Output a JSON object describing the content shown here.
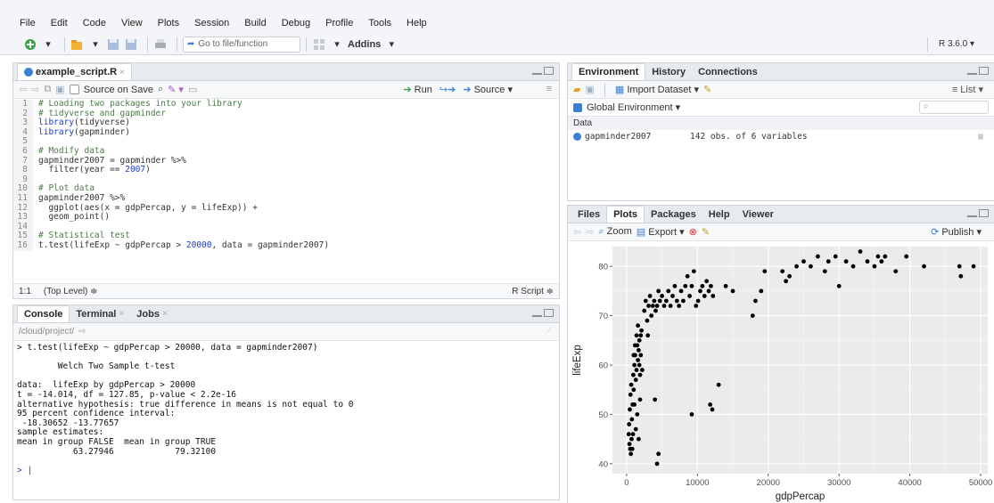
{
  "menu": [
    "File",
    "Edit",
    "Code",
    "View",
    "Plots",
    "Session",
    "Build",
    "Debug",
    "Profile",
    "Tools",
    "Help"
  ],
  "toolbar": {
    "goto_placeholder": "Go to file/function",
    "addins_label": "Addins",
    "r_version": "R 3.6.0"
  },
  "editor": {
    "tab_label": "example_script.R",
    "source_on_save": "Source on Save",
    "run_label": "Run",
    "source_label": "Source",
    "lines": [
      {
        "n": "1",
        "html": "<span class='comment'># Loading two packages into your library</span>"
      },
      {
        "n": "2",
        "html": "<span class='comment'># tidyverse and gapminder</span>"
      },
      {
        "n": "3",
        "html": "<span class='kw'>library</span>(tidyverse)"
      },
      {
        "n": "4",
        "html": "<span class='kw'>library</span>(gapminder)"
      },
      {
        "n": "5",
        "html": ""
      },
      {
        "n": "6",
        "html": "<span class='comment'># Modify data</span>"
      },
      {
        "n": "7",
        "html": "gapminder2007 = gapminder %&gt;%"
      },
      {
        "n": "8",
        "html": "  filter(year == <span class='num'>2007</span>)"
      },
      {
        "n": "9",
        "html": ""
      },
      {
        "n": "10",
        "html": "<span class='comment'># Plot data</span>"
      },
      {
        "n": "11",
        "html": "gapminder2007 %&gt;%"
      },
      {
        "n": "12",
        "html": "  ggplot(aes(x = gdpPercap, y = lifeExp)) +"
      },
      {
        "n": "13",
        "html": "  geom_point()"
      },
      {
        "n": "14",
        "html": ""
      },
      {
        "n": "15",
        "html": "<span class='comment'># Statistical test</span>"
      },
      {
        "n": "16",
        "html": "t.test(lifeExp ~ gdpPercap &gt; <span class='num'>20000</span>, data = gapminder2007)"
      }
    ],
    "status_pos": "1:1",
    "status_level": "(Top Level) ≑",
    "status_type": "R Script ≑"
  },
  "console": {
    "tabs": [
      "Console",
      "Terminal",
      "Jobs"
    ],
    "path": "/cloud/project/",
    "output": "> t.test(lifeExp ~ gdpPercap > 20000, data = gapminder2007)\n\n        Welch Two Sample t-test\n\ndata:  lifeExp by gdpPercap > 20000\nt = -14.014, df = 127.85, p-value < 2.2e-16\nalternative hypothesis: true difference in means is not equal to 0\n95 percent confidence interval:\n -18.30652 -13.77657\nsample estimates:\nmean in group FALSE  mean in group TRUE\n           63.27946            79.32100\n\n",
    "prompt": "> |"
  },
  "environment": {
    "tabs": [
      "Environment",
      "History",
      "Connections"
    ],
    "import_label": "Import Dataset",
    "list_label": "List",
    "scope_label": "Global Environment",
    "section": "Data",
    "var_name": "gapminder2007",
    "var_desc": "142 obs. of 6 variables"
  },
  "plots": {
    "tabs": [
      "Files",
      "Plots",
      "Packages",
      "Help",
      "Viewer"
    ],
    "zoom_label": "Zoom",
    "export_label": "Export",
    "publish_label": "Publish"
  },
  "chart_data": {
    "type": "scatter",
    "xlabel": "gdpPercap",
    "ylabel": "lifeExp",
    "xlim": [
      -2000,
      51000
    ],
    "ylim": [
      38,
      84
    ],
    "xticks": [
      0,
      10000,
      20000,
      30000,
      40000,
      50000
    ],
    "xtick_labels": [
      "0",
      "10000",
      "20000",
      "30000",
      "40000",
      "50000"
    ],
    "yticks": [
      40,
      50,
      60,
      70,
      80
    ],
    "ytick_labels": [
      "40",
      "50",
      "60",
      "70",
      "80"
    ],
    "grid": true,
    "points": [
      [
        300,
        46
      ],
      [
        400,
        44
      ],
      [
        500,
        43
      ],
      [
        600,
        42
      ],
      [
        700,
        45
      ],
      [
        800,
        43
      ],
      [
        900,
        46
      ],
      [
        350,
        48
      ],
      [
        450,
        51
      ],
      [
        550,
        54
      ],
      [
        650,
        56
      ],
      [
        750,
        49
      ],
      [
        850,
        52
      ],
      [
        950,
        58
      ],
      [
        1000,
        55
      ],
      [
        1100,
        60
      ],
      [
        1200,
        62
      ],
      [
        1300,
        57
      ],
      [
        1400,
        59
      ],
      [
        1500,
        64
      ],
      [
        1600,
        61
      ],
      [
        1700,
        63
      ],
      [
        1800,
        65
      ],
      [
        1900,
        58
      ],
      [
        2000,
        66
      ],
      [
        2100,
        67
      ],
      [
        1000,
        62
      ],
      [
        1200,
        64
      ],
      [
        1400,
        66
      ],
      [
        1600,
        68
      ],
      [
        1800,
        60
      ],
      [
        2000,
        62
      ],
      [
        1100,
        52
      ],
      [
        1300,
        47
      ],
      [
        1500,
        50
      ],
      [
        1700,
        45
      ],
      [
        1900,
        53
      ],
      [
        2200,
        59
      ],
      [
        2500,
        71
      ],
      [
        2700,
        73
      ],
      [
        2900,
        69
      ],
      [
        3100,
        72
      ],
      [
        3300,
        74
      ],
      [
        3500,
        70
      ],
      [
        3700,
        72
      ],
      [
        3900,
        73
      ],
      [
        4100,
        71
      ],
      [
        4300,
        72
      ],
      [
        4500,
        75
      ],
      [
        4700,
        73
      ],
      [
        5000,
        74
      ],
      [
        5300,
        72
      ],
      [
        5600,
        73
      ],
      [
        5900,
        75
      ],
      [
        6200,
        72
      ],
      [
        6500,
        74
      ],
      [
        6800,
        76
      ],
      [
        7100,
        73
      ],
      [
        7400,
        72
      ],
      [
        7700,
        75
      ],
      [
        8000,
        73
      ],
      [
        8300,
        76
      ],
      [
        8600,
        78
      ],
      [
        8900,
        74
      ],
      [
        9200,
        76
      ],
      [
        9500,
        79
      ],
      [
        9800,
        72
      ],
      [
        10100,
        73
      ],
      [
        10400,
        75
      ],
      [
        10700,
        76
      ],
      [
        11000,
        74
      ],
      [
        11300,
        77
      ],
      [
        11600,
        75
      ],
      [
        11900,
        76
      ],
      [
        12200,
        74
      ],
      [
        3000,
        66
      ],
      [
        4000,
        53
      ],
      [
        4500,
        42
      ],
      [
        4300,
        40
      ],
      [
        9200,
        50
      ],
      [
        11800,
        52
      ],
      [
        12100,
        51
      ],
      [
        13000,
        56
      ],
      [
        14000,
        76
      ],
      [
        15000,
        75
      ],
      [
        17800,
        70
      ],
      [
        18200,
        73
      ],
      [
        19000,
        75
      ],
      [
        19500,
        79
      ],
      [
        22000,
        79
      ],
      [
        22500,
        77
      ],
      [
        23000,
        78
      ],
      [
        24000,
        80
      ],
      [
        25000,
        81
      ],
      [
        26000,
        80
      ],
      [
        27000,
        82
      ],
      [
        28000,
        79
      ],
      [
        28500,
        81
      ],
      [
        29500,
        82
      ],
      [
        30000,
        76
      ],
      [
        31000,
        81
      ],
      [
        32000,
        80
      ],
      [
        33000,
        83
      ],
      [
        34000,
        81
      ],
      [
        35000,
        80
      ],
      [
        35500,
        82
      ],
      [
        36000,
        81
      ],
      [
        36500,
        82
      ],
      [
        38000,
        79
      ],
      [
        39500,
        82
      ],
      [
        42000,
        80
      ],
      [
        47000,
        80
      ],
      [
        47200,
        78
      ],
      [
        49000,
        80
      ]
    ]
  }
}
